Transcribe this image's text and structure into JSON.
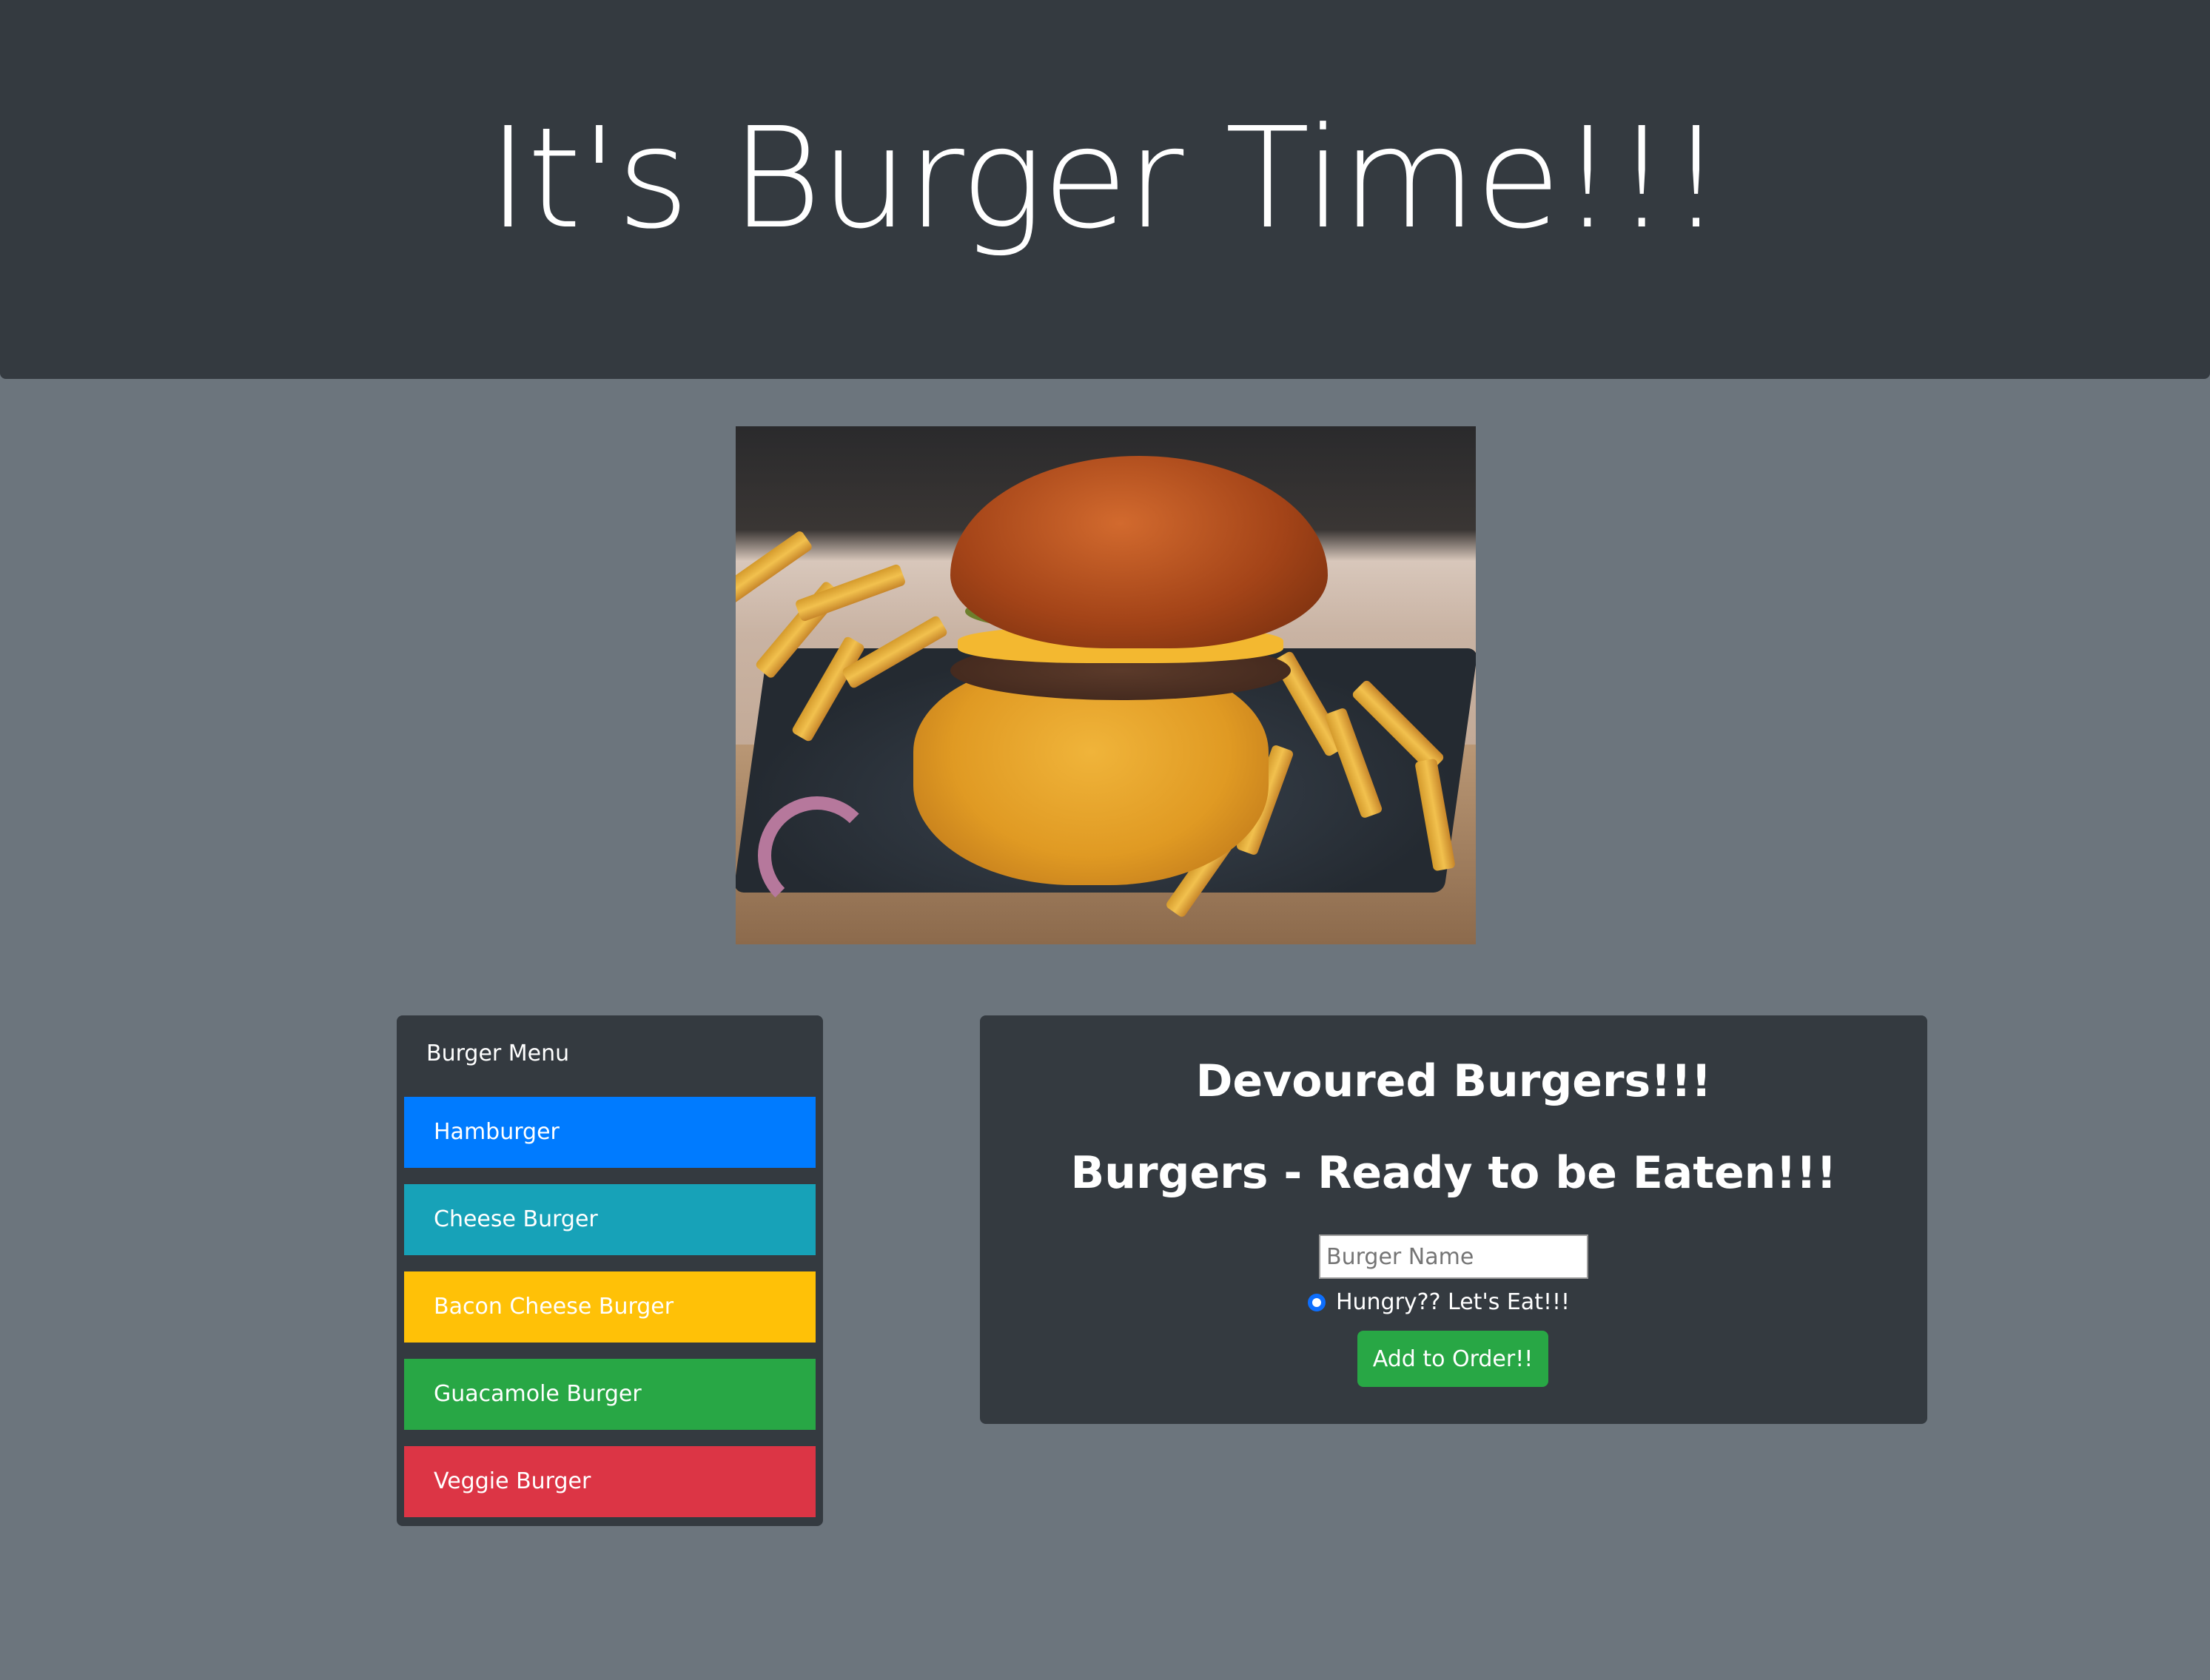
{
  "header": {
    "title": "It's Burger Time!!!"
  },
  "hero_image": {
    "alt": "burger with fries"
  },
  "menu": {
    "title": "Burger Menu",
    "items": [
      {
        "label": "Hamburger",
        "color": "#007bff"
      },
      {
        "label": "Cheese Burger",
        "color": "#17a2b8"
      },
      {
        "label": "Bacon Cheese Burger",
        "color": "#ffc107"
      },
      {
        "label": "Guacamole Burger",
        "color": "#28a745"
      },
      {
        "label": "Veggie Burger",
        "color": "#dc3545"
      }
    ]
  },
  "order": {
    "devoured_title": "Devoured Burgers!!!",
    "ready_title": "Burgers - Ready to be Eaten!!!",
    "input_placeholder": "Burger Name",
    "input_value": "",
    "radio_label": "Hungry?? Let's Eat!!!",
    "button_label": "Add to Order!!"
  },
  "colors": {
    "page_bg": "#6c757d",
    "panel_bg": "#343a40",
    "button_green": "#28a745"
  }
}
